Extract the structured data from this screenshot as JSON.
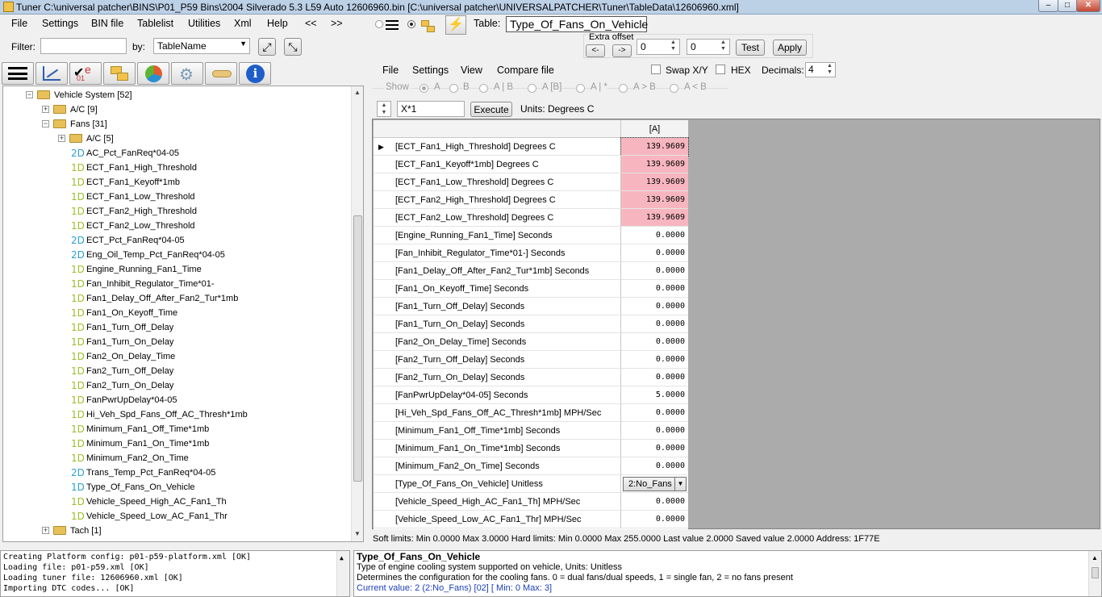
{
  "titlebar": {
    "title": "Tuner C:\\universal patcher\\BINS\\P01_P59 Bins\\2004 Silverado 5.3 L59 Auto 12606960.bin [C:\\universal patcher\\UNIVERSALPATCHER\\Tuner\\TableData\\12606960.xml]",
    "minimize": "–",
    "maximize": "□",
    "close": "✕"
  },
  "menu": [
    "File",
    "Settings",
    "BIN file",
    "Tablelist",
    "Utilities",
    "Xml",
    "Help",
    "<<",
    ">>"
  ],
  "table_label": "Table:",
  "table_name": "Type_Of_Fans_On_Vehicle",
  "filter": {
    "label": "Filter:",
    "value": "",
    "by_label": "by:",
    "by_value": "TableName"
  },
  "extra_offset": {
    "label": "Extra offset",
    "prev": "<-",
    "next": "->",
    "value1": "0",
    "value2": "0",
    "test": "Test",
    "apply": "Apply"
  },
  "tree": {
    "rows": [
      {
        "label": "Vehicle System [52]",
        "type": "folder",
        "depth": 0,
        "expander": "−"
      },
      {
        "label": "A/C [9]",
        "type": "folder",
        "depth": 1,
        "expander": "+"
      },
      {
        "label": "Fans [31]",
        "type": "folder",
        "depth": 1,
        "expander": "−"
      },
      {
        "label": "A/C [5]",
        "type": "folder",
        "depth": 2,
        "expander": "+"
      },
      {
        "label": "AC_Pct_FanReq*04-05",
        "type": "2D",
        "depth": 2
      },
      {
        "label": "ECT_Fan1_High_Threshold",
        "type": "1D",
        "depth": 2
      },
      {
        "label": "ECT_Fan1_Keyoff*1mb",
        "type": "1D",
        "depth": 2
      },
      {
        "label": "ECT_Fan1_Low_Threshold",
        "type": "1D",
        "depth": 2
      },
      {
        "label": "ECT_Fan2_High_Threshold",
        "type": "1D",
        "depth": 2
      },
      {
        "label": "ECT_Fan2_Low_Threshold",
        "type": "1D",
        "depth": 2
      },
      {
        "label": "ECT_Pct_FanReq*04-05",
        "type": "2D",
        "depth": 2
      },
      {
        "label": "Eng_Oil_Temp_Pct_FanReq*04-05",
        "type": "2D",
        "depth": 2
      },
      {
        "label": "Engine_Running_Fan1_Time",
        "type": "1D",
        "depth": 2
      },
      {
        "label": "Fan_Inhibit_Regulator_Time*01-",
        "type": "1D",
        "depth": 2
      },
      {
        "label": "Fan1_Delay_Off_After_Fan2_Tur*1mb",
        "type": "1D",
        "depth": 2
      },
      {
        "label": "Fan1_On_Keyoff_Time",
        "type": "1D",
        "depth": 2
      },
      {
        "label": "Fan1_Turn_Off_Delay",
        "type": "1D",
        "depth": 2
      },
      {
        "label": "Fan1_Turn_On_Delay",
        "type": "1D",
        "depth": 2
      },
      {
        "label": "Fan2_On_Delay_Time",
        "type": "1D",
        "depth": 2
      },
      {
        "label": "Fan2_Turn_Off_Delay",
        "type": "1D",
        "depth": 2
      },
      {
        "label": "Fan2_Turn_On_Delay",
        "type": "1D",
        "depth": 2
      },
      {
        "label": "FanPwrUpDelay*04-05",
        "type": "1D",
        "depth": 2
      },
      {
        "label": "Hi_Veh_Spd_Fans_Off_AC_Thresh*1mb",
        "type": "1D",
        "depth": 2
      },
      {
        "label": "Minimum_Fan1_Off_Time*1mb",
        "type": "1D",
        "depth": 2
      },
      {
        "label": "Minimum_Fan1_On_Time*1mb",
        "type": "1D",
        "depth": 2
      },
      {
        "label": "Minimum_Fan2_On_Time",
        "type": "1D",
        "depth": 2
      },
      {
        "label": "Trans_Temp_Pct_FanReq*04-05",
        "type": "2D",
        "depth": 2
      },
      {
        "label": "Type_Of_Fans_On_Vehicle",
        "type": "1Dsel",
        "depth": 2
      },
      {
        "label": "Vehicle_Speed_High_AC_Fan1_Th",
        "type": "1D",
        "depth": 2
      },
      {
        "label": "Vehicle_Speed_Low_AC_Fan1_Thr",
        "type": "1D",
        "depth": 2
      },
      {
        "label": "Tach [1]",
        "type": "folder",
        "depth": 1,
        "expander": "+"
      }
    ]
  },
  "editor_menu": [
    "File",
    "Settings",
    "View",
    "Compare file"
  ],
  "swap_xy": "Swap X/Y",
  "hex": "HEX",
  "decimals": {
    "label": "Decimals:",
    "value": "4"
  },
  "show": {
    "label": "Show",
    "options": [
      "A",
      "B",
      "A | B",
      "A [B]",
      "A | *",
      "A > B",
      "A < B"
    ]
  },
  "formula": {
    "value": "X*1",
    "execute": "Execute",
    "units": "Units: Degrees C"
  },
  "grid": {
    "col_header": "[A]",
    "rows": [
      {
        "name": "[ECT_Fan1_High_Threshold] Degrees C",
        "value": "139.9609",
        "hi": true,
        "current": true
      },
      {
        "name": "[ECT_Fan1_Keyoff*1mb] Degrees C",
        "value": "139.9609",
        "hi": true
      },
      {
        "name": "[ECT_Fan1_Low_Threshold] Degrees C",
        "value": "139.9609",
        "hi": true
      },
      {
        "name": "[ECT_Fan2_High_Threshold] Degrees C",
        "value": "139.9609",
        "hi": true
      },
      {
        "name": "[ECT_Fan2_Low_Threshold] Degrees C",
        "value": "139.9609",
        "hi": true
      },
      {
        "name": "[Engine_Running_Fan1_Time] Seconds",
        "value": "0.0000"
      },
      {
        "name": "[Fan_Inhibit_Regulator_Time*01-] Seconds",
        "value": "0.0000"
      },
      {
        "name": "[Fan1_Delay_Off_After_Fan2_Tur*1mb] Seconds",
        "value": "0.0000"
      },
      {
        "name": "[Fan1_On_Keyoff_Time] Seconds",
        "value": "0.0000"
      },
      {
        "name": "[Fan1_Turn_Off_Delay] Seconds",
        "value": "0.0000"
      },
      {
        "name": "[Fan1_Turn_On_Delay] Seconds",
        "value": "0.0000"
      },
      {
        "name": "[Fan2_On_Delay_Time] Seconds",
        "value": "0.0000"
      },
      {
        "name": "[Fan2_Turn_Off_Delay] Seconds",
        "value": "0.0000"
      },
      {
        "name": "[Fan2_Turn_On_Delay] Seconds",
        "value": "0.0000"
      },
      {
        "name": "[FanPwrUpDelay*04-05] Seconds",
        "value": "5.0000"
      },
      {
        "name": "[Hi_Veh_Spd_Fans_Off_AC_Thresh*1mb] MPH/Sec",
        "value": "0.0000"
      },
      {
        "name": "[Minimum_Fan1_Off_Time*1mb] Seconds",
        "value": "0.0000"
      },
      {
        "name": "[Minimum_Fan1_On_Time*1mb] Seconds",
        "value": "0.0000"
      },
      {
        "name": "[Minimum_Fan2_On_Time] Seconds",
        "value": "0.0000"
      },
      {
        "name": "[Type_Of_Fans_On_Vehicle] Unitless",
        "value": "2:No_Fans",
        "dropdown": true
      },
      {
        "name": "[Vehicle_Speed_High_AC_Fan1_Th] MPH/Sec",
        "value": "0.0000"
      },
      {
        "name": "[Vehicle_Speed_Low_AC_Fan1_Thr] MPH/Sec",
        "value": "0.0000"
      }
    ]
  },
  "status": "Soft limits: Min 0.0000 Max 3.0000 Hard limits: Min 0.0000 Max 255.0000 Last value 2.0000 Saved value 2.0000 Address: 1F77E",
  "log": [
    "Creating Platform config: p01-p59-platform.xml [OK]",
    "Loading file: p01-p59.xml [OK]",
    "Loading tuner file: 12606960.xml [OK]",
    "Importing DTC codes... [OK]"
  ],
  "info": {
    "title": "Type_Of_Fans_On_Vehicle",
    "line1": "Type of engine cooling system supported on vehicle, Units: Unitless",
    "line2": "Determines the configuration for the cooling fans. 0 = dual fans/dual speeds, 1 = single fan, 2 = no fans present",
    "line3": "Current value: 2 (2:No_Fans) [02] [ Min: 0 Max: 3]"
  },
  "colors": {
    "highlight": "#f7b6bf",
    "info_link": "#1a3fb8",
    "dim1": "#9bbf2a",
    "dim2": "#2d9fd3"
  }
}
